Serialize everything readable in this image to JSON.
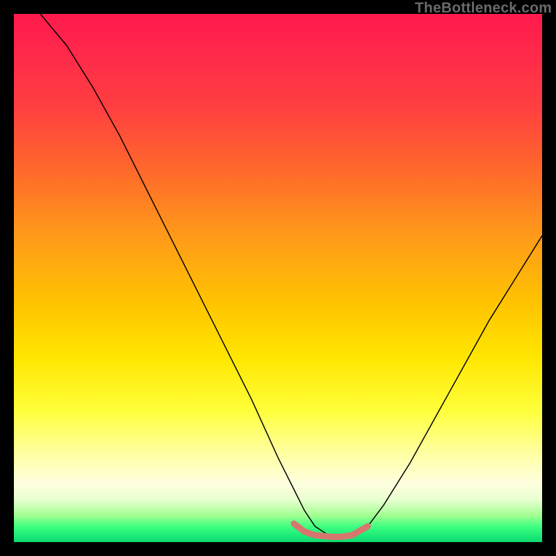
{
  "watermark": {
    "text": "TheBottleneck.com"
  },
  "chart_data": {
    "type": "line",
    "title": "",
    "xlabel": "",
    "ylabel": "",
    "xlim": [
      0,
      100
    ],
    "ylim": [
      0,
      100
    ],
    "series": [
      {
        "name": "bottleneck-curve",
        "stroke": "#000000",
        "stroke_width": 1.5,
        "x": [
          5,
          10,
          15,
          20,
          25,
          30,
          35,
          40,
          45,
          50,
          53,
          55,
          57,
          60,
          62,
          64,
          67,
          70,
          75,
          80,
          85,
          90,
          95,
          100
        ],
        "y": [
          100,
          94,
          86,
          77,
          67,
          57,
          47,
          37,
          27,
          16,
          10,
          6,
          3,
          1,
          1,
          1,
          3,
          7,
          15,
          24,
          33,
          42,
          50,
          58
        ]
      },
      {
        "name": "optimal-band",
        "stroke": "#d7766f",
        "stroke_width": 9,
        "x": [
          53,
          55,
          57,
          60,
          62,
          64,
          67
        ],
        "y": [
          3.5,
          2.0,
          1.3,
          1.0,
          1.0,
          1.3,
          3.0
        ]
      }
    ],
    "gradient_stops": [
      {
        "pos": 0.0,
        "color": "#ff1a4d"
      },
      {
        "pos": 0.18,
        "color": "#ff4040"
      },
      {
        "pos": 0.42,
        "color": "#ff9a1a"
      },
      {
        "pos": 0.65,
        "color": "#ffe600"
      },
      {
        "pos": 0.83,
        "color": "#ffffa0"
      },
      {
        "pos": 0.95,
        "color": "#a0ff90"
      },
      {
        "pos": 1.0,
        "color": "#10d870"
      }
    ]
  }
}
